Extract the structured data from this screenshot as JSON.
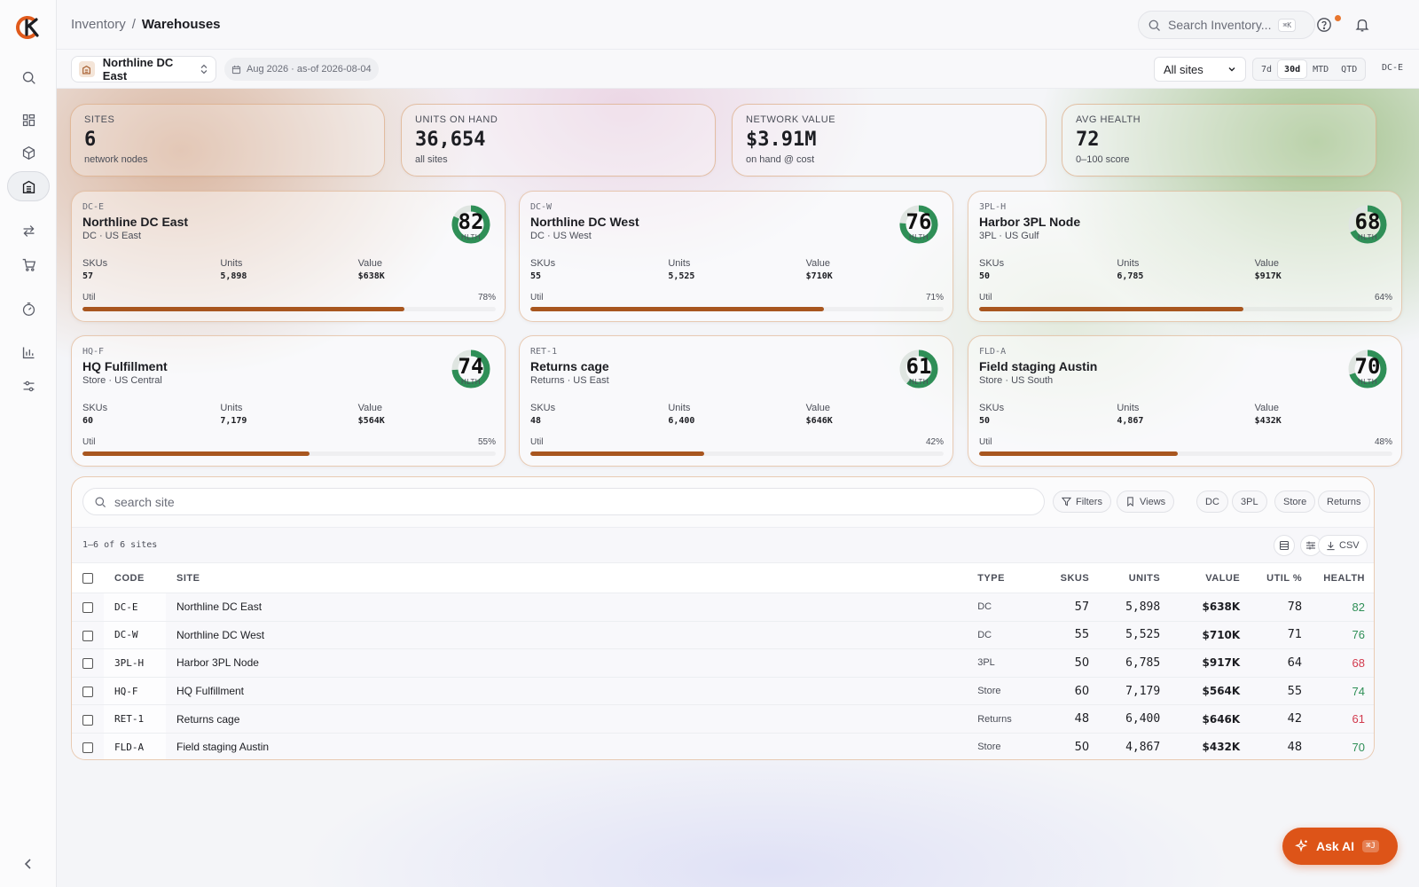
{
  "nav": {
    "items": [
      {
        "name": "search",
        "icon": "search-icon"
      },
      {
        "name": "dashboard",
        "icon": "grid-icon"
      },
      {
        "name": "products",
        "icon": "cube-icon"
      },
      {
        "name": "warehouses",
        "icon": "building-icon",
        "active": true
      },
      {
        "name": "transfers",
        "icon": "transfer-icon"
      },
      {
        "name": "orders",
        "icon": "cart-icon"
      },
      {
        "name": "timer",
        "icon": "stopwatch-icon"
      },
      {
        "name": "reports",
        "icon": "bar-chart-icon"
      },
      {
        "name": "settings",
        "icon": "sliders-icon"
      }
    ]
  },
  "breadcrumb": {
    "parent": "Inventory",
    "separator": "/",
    "current": "Warehouses"
  },
  "search": {
    "placeholder": "Search Inventory...",
    "shortcut": "⌘K"
  },
  "subbar": {
    "site": "Northline DC East",
    "date": "Aug 2026 · as-of 2026-08-04",
    "sites_filter": "All sites",
    "ranges": [
      "7d",
      "30d",
      "MTD",
      "QTD"
    ],
    "active_range": "30d",
    "site_code": "DC-E"
  },
  "kpis": [
    {
      "label": "SITES",
      "value": "6",
      "sub": "network nodes"
    },
    {
      "label": "UNITS ON HAND",
      "value": "36,654",
      "sub": "all sites"
    },
    {
      "label": "NETWORK VALUE",
      "value": "$3.91M",
      "sub": "on hand @ cost"
    },
    {
      "label": "AVG HEALTH",
      "value": "72",
      "sub": "0–100 score"
    }
  ],
  "site_cards": [
    {
      "code": "DC-E",
      "name": "Northline DC East",
      "type": "DC · US East",
      "health": 82,
      "health_label": "HLTH",
      "skus": "57",
      "units": "5,898",
      "value": "$638K",
      "util": 78,
      "util_label": "78%"
    },
    {
      "code": "DC-W",
      "name": "Northline DC West",
      "type": "DC · US West",
      "health": 76,
      "health_label": "HLTH",
      "skus": "55",
      "units": "5,525",
      "value": "$710K",
      "util": 71,
      "util_label": "71%"
    },
    {
      "code": "3PL-H",
      "name": "Harbor 3PL Node",
      "type": "3PL · US Gulf",
      "health": 68,
      "health_label": "HLTH",
      "skus": "50",
      "units": "6,785",
      "value": "$917K",
      "util": 64,
      "util_label": "64%"
    },
    {
      "code": "HQ-F",
      "name": "HQ Fulfillment",
      "type": "Store · US Central",
      "health": 74,
      "health_label": "HLTH",
      "skus": "60",
      "units": "7,179",
      "value": "$564K",
      "util": 55,
      "util_label": "55%"
    },
    {
      "code": "RET-1",
      "name": "Returns cage",
      "type": "Returns · US East",
      "health": 61,
      "health_label": "HLTH",
      "skus": "48",
      "units": "6,400",
      "value": "$646K",
      "util": 42,
      "util_label": "42%"
    },
    {
      "code": "FLD-A",
      "name": "Field staging Austin",
      "type": "Store · US South",
      "health": 70,
      "health_label": "HLTH",
      "skus": "50",
      "units": "4,867",
      "value": "$432K",
      "util": 48,
      "util_label": "48%"
    }
  ],
  "card_labels": {
    "skus": "SKUs",
    "units": "Units",
    "value": "Value",
    "util": "Util"
  },
  "table": {
    "search_placeholder": "search site",
    "filters_label": "Filters",
    "views_label": "Views",
    "type_chips": [
      "DC",
      "3PL",
      "Store",
      "Returns"
    ],
    "count": "1–6 of 6 sites",
    "csv_label": "CSV",
    "columns": [
      "CODE",
      "SITE",
      "TYPE",
      "SKUS",
      "UNITS",
      "VALUE",
      "UTIL %",
      "HEALTH"
    ],
    "rows": [
      {
        "code": "DC-E",
        "site": "Northline DC East",
        "type": "DC",
        "skus": "57",
        "units": "5,898",
        "value": "$638K",
        "util": "78",
        "health": "82",
        "health_color": "#2f8f57"
      },
      {
        "code": "DC-W",
        "site": "Northline DC West",
        "type": "DC",
        "skus": "55",
        "units": "5,525",
        "value": "$710K",
        "util": "71",
        "health": "76",
        "health_color": "#2f8f57"
      },
      {
        "code": "3PL-H",
        "site": "Harbor 3PL Node",
        "type": "3PL",
        "skus": "50",
        "units": "6,785",
        "value": "$917K",
        "util": "64",
        "health": "68",
        "health_color": "#d23a4e"
      },
      {
        "code": "HQ-F",
        "site": "HQ Fulfillment",
        "type": "Store",
        "skus": "60",
        "units": "7,179",
        "value": "$564K",
        "util": "55",
        "health": "74",
        "health_color": "#2f8f57"
      },
      {
        "code": "RET-1",
        "site": "Returns cage",
        "type": "Returns",
        "skus": "48",
        "units": "6,400",
        "value": "$646K",
        "util": "42",
        "health": "61",
        "health_color": "#d23a4e"
      },
      {
        "code": "FLD-A",
        "site": "Field staging Austin",
        "type": "Store",
        "skus": "50",
        "units": "4,867",
        "value": "$432K",
        "util": "48",
        "health": "70",
        "health_color": "#2f8f57"
      }
    ]
  },
  "ask_ai": {
    "label": "Ask AI",
    "shortcut": "⌘J"
  },
  "colors": {
    "accent": "#dd5418",
    "util_bar": "#a8561f",
    "gauge": "#2f8f57",
    "good": "#2f8f57",
    "warn": "#d23a4e"
  }
}
